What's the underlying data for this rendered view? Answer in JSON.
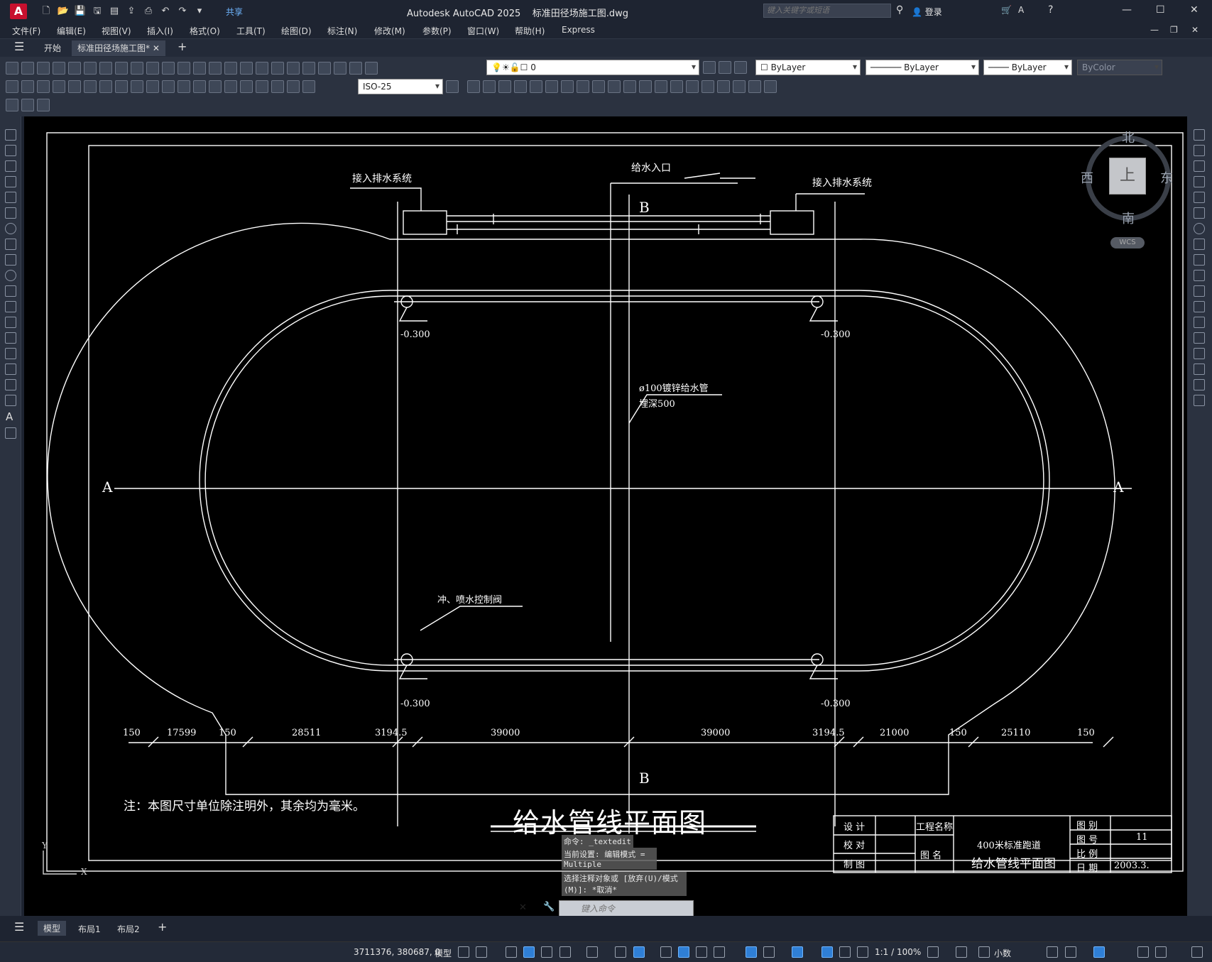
{
  "app": {
    "title": "Autodesk AutoCAD 2025",
    "file": "标准田径场施工图.dwg",
    "share_label": "共享",
    "search_placeholder": "键入关键字或短语",
    "login_label": "登录",
    "logo": "A"
  },
  "menu": [
    "文件(F)",
    "编辑(E)",
    "视图(V)",
    "插入(I)",
    "格式(O)",
    "工具(T)",
    "绘图(D)",
    "标注(N)",
    "修改(M)",
    "参数(P)",
    "窗口(W)",
    "帮助(H)",
    "Express"
  ],
  "tabs": {
    "start": "开始",
    "drawing": "标准田径场施工图*",
    "add": "+"
  },
  "toolbar": {
    "layer_value": "0",
    "color_value": "ByLayer",
    "linetype_value": "ByLayer",
    "lineweight_value": "ByLayer",
    "plotstyle_value": "ByColor",
    "dimstyle_value": "ISO-25"
  },
  "viewcube": {
    "north": "北",
    "south": "南",
    "east": "东",
    "west": "西",
    "face": "上",
    "wcs": "WCS"
  },
  "drawing": {
    "labels": {
      "drain_left": "接入排水系统",
      "drain_right": "接入排水系统",
      "water_inlet": "给水入口",
      "pipe_spec": "ø100镀锌给水管",
      "pipe_depth": "埋深500",
      "valve": "冲、喷水控制阀",
      "section_a": "A",
      "section_b": "B",
      "elev_tl": "-0.300",
      "elev_tr": "-0.300",
      "elev_bl": "-0.300",
      "elev_br": "-0.300",
      "note": "注：本图尺寸单位除注明外，其余均为毫米。",
      "main_title": "给水管线平面图"
    },
    "dimensions": [
      "150",
      "17599",
      "150",
      "28511",
      "3194.5",
      "39000",
      "39000",
      "3194.5",
      "21000",
      "150",
      "25110",
      "150"
    ],
    "titleblock": {
      "design": "设 计",
      "check": "校 对",
      "draw": "制 图",
      "project_name_label": "工程名称",
      "drawing_name_label": "图 名",
      "project": "400米标准跑道",
      "drawing_name": "给水管线平面图",
      "category_label": "图 别",
      "number_label": "图 号",
      "number": "11",
      "scale_label": "比 例",
      "date_label": "日 期",
      "date": "2003.3."
    }
  },
  "command": {
    "history": [
      "命令: _textedit",
      "当前设置: 编辑模式 = Multiple",
      "选择注释对象或 [放弃(U)/模式(M)]: *取消*"
    ],
    "placeholder": "键入命令"
  },
  "layouts": {
    "model": "模型",
    "layout1": "布局1",
    "layout2": "布局2"
  },
  "status": {
    "coords": "3711376, 380687, 0",
    "space": "模型",
    "scale": "1:1 / 100%",
    "units": "小数"
  }
}
